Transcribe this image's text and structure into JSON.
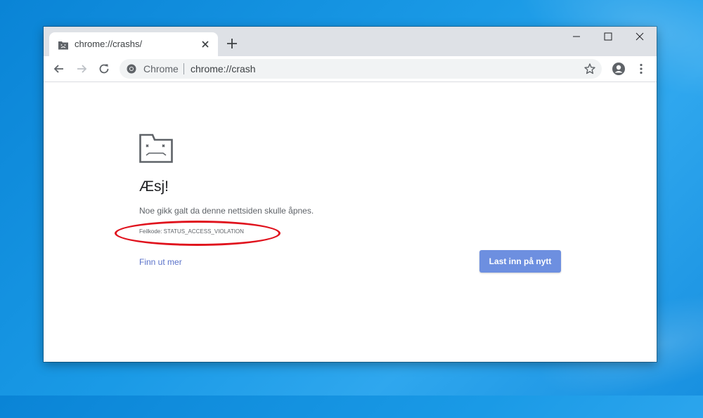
{
  "browser": {
    "tab": {
      "title": "chrome://crashs/",
      "icon": "sad-face-favicon-icon"
    },
    "window_controls": [
      "minimize-icon",
      "maximize-icon",
      "close-icon"
    ],
    "omnibox": {
      "chip": "Chrome",
      "url": "chrome://crash"
    }
  },
  "page": {
    "heading": "Æsj!",
    "description": "Noe gikk galt da denne nettsiden skulle åpnes.",
    "error_code": "Feilkode: STATUS_ACCESS_VIOLATION",
    "learn_more": "Finn ut mer",
    "reload_button": "Last inn på nytt"
  },
  "colors": {
    "desktop": "#1a9ae6",
    "accent_button": "#6d8fe0",
    "annotation": "#e0121d",
    "link": "#5a72c9"
  }
}
